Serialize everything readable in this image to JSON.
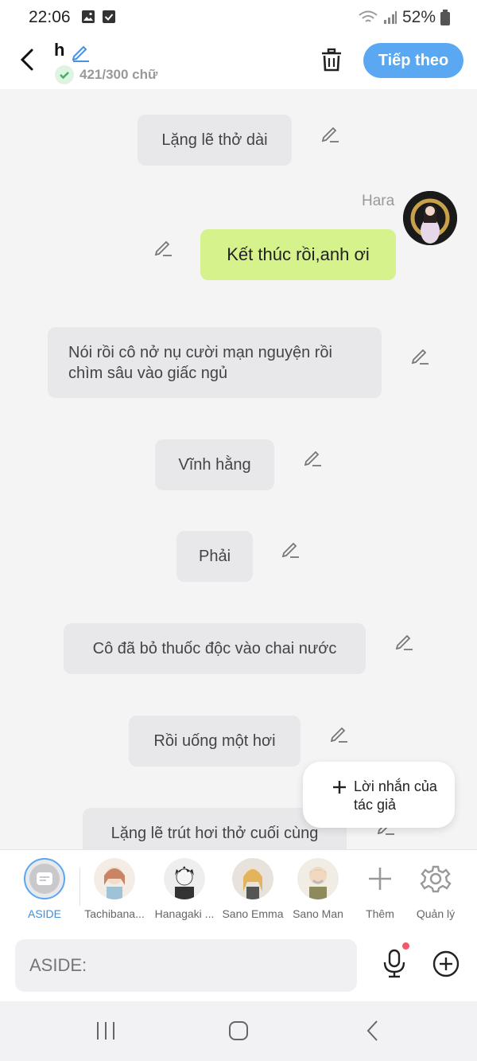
{
  "status": {
    "time": "22:06",
    "battery": "52%"
  },
  "header": {
    "title": "h",
    "word_count": "421/300 chữ",
    "next_label": "Tiếp theo"
  },
  "messages": [
    {
      "text": "Lặng lẽ thở dài"
    },
    {
      "speaker": "Hara",
      "text": "Kết thúc rồi,anh ơi"
    },
    {
      "text": "Nói rồi cô nở nụ cười mạn nguyện rồi chìm sâu vào giấc ngủ"
    },
    {
      "text": "Vĩnh hằng"
    },
    {
      "text": "Phải"
    },
    {
      "text": "Cô đã bỏ thuốc độc vào chai nước"
    },
    {
      "text": "Rồi uống một hơi"
    },
    {
      "text": "Lặng lẽ trút hơi thở cuối cùng"
    }
  ],
  "author_note": {
    "label": "Lời nhắn của tác giả"
  },
  "characters": [
    {
      "label": "ASIDE"
    },
    {
      "label": "Tachibana..."
    },
    {
      "label": "Hanagaki ..."
    },
    {
      "label": "Sano Emma"
    },
    {
      "label": "Sano Man"
    },
    {
      "label": "Thêm"
    },
    {
      "label": "Quản lý"
    }
  ],
  "input": {
    "placeholder": "ASIDE:"
  },
  "colors": {
    "accent": "#5aa7f2",
    "user_bubble": "#d6f28c",
    "bubble": "#e8e8ea"
  }
}
